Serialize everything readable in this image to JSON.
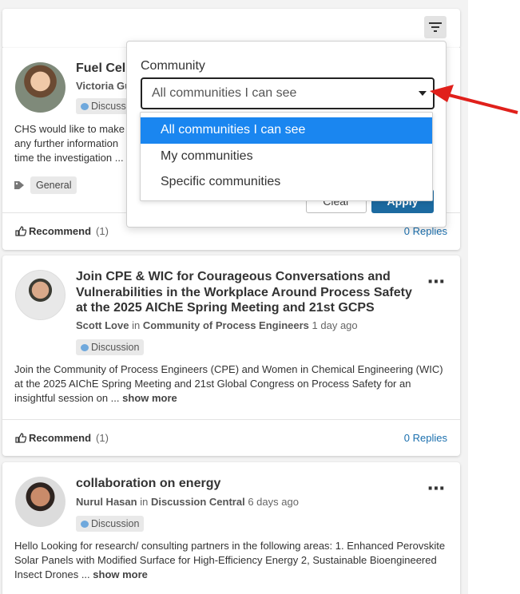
{
  "feed": {
    "posts": [
      {
        "title": "Fuel Cell",
        "author": "Victoria Gu",
        "in_word": "",
        "community": "",
        "time": "",
        "badge": "Discuss",
        "body": "CHS would like to make\nany further information\ntime the investigation ...",
        "tag": "General",
        "recommend_label": "Recommend",
        "recommend_count": "(1)",
        "replies": "0 Replies"
      },
      {
        "title": "Join CPE & WIC for Courageous Conversations and Vulnerabilities in the Workplace Around Process Safety at the 2025 AIChE Spring Meeting and 21st GCPS",
        "author": "Scott Love",
        "in_word": "in",
        "community": "Community of Process Engineers",
        "time": "1 day ago",
        "badge": "Discussion",
        "body": "Join the Community of Process Engineers (CPE) and Women in Chemical Engineering (WIC) at the 2025 AIChE Spring Meeting and 21st Global Congress on Process Safety for an insightful session on ...",
        "show_more": "show more",
        "recommend_label": "Recommend",
        "recommend_count": "(1)",
        "replies": "0 Replies"
      },
      {
        "title": "collaboration on energy",
        "author": "Nurul Hasan",
        "in_word": "in",
        "community": "Discussion Central",
        "time": "6 days ago",
        "badge": "Discussion",
        "body": "Hello Looking for research/ consulting partners in the following areas: 1. Enhanced Perovskite Solar Panels with Modified Surface for High-Efficiency Energy 2, Sustainable Bioengineered Insect Drones ...",
        "show_more": "show more"
      }
    ],
    "more_icon": "⋯"
  },
  "filter_popover": {
    "label": "Community",
    "selected": "All communities I can see",
    "clear_label": "Clear",
    "apply_label": "Apply",
    "options": [
      "All communities I can see",
      "My communities",
      "Specific communities"
    ]
  },
  "colors": {
    "accent": "#1c6aa0",
    "selected_option": "#1a86f0",
    "annotation_arrow": "#e0201b"
  },
  "icons": [
    "filter-icon",
    "thumbs-up-icon",
    "tag-icon",
    "chat-bubble-icon",
    "more-icon",
    "caret-down-icon",
    "red-arrow-icon"
  ]
}
